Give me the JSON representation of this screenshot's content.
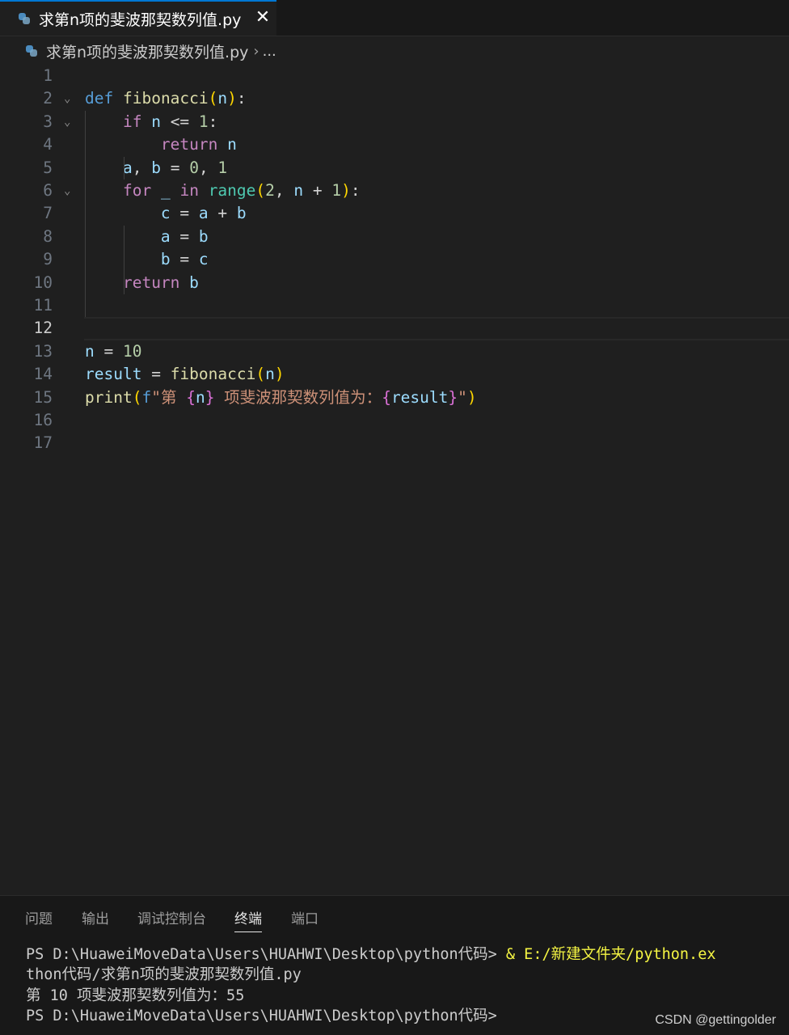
{
  "tab": {
    "title": "求第n项的斐波那契数列值.py",
    "icon": "python-icon",
    "close": "✕"
  },
  "breadcrumb": {
    "file": "求第n项的斐波那契数列值.py",
    "separator": "›",
    "more": "..."
  },
  "editor": {
    "current_line": 12,
    "lines": [
      {
        "n": "1",
        "tokens": []
      },
      {
        "n": "2",
        "fold": true,
        "tokens": [
          [
            "kw",
            "def"
          ],
          [
            "op",
            " "
          ],
          [
            "fn",
            "fibonacci"
          ],
          [
            "b1",
            "("
          ],
          [
            "var",
            "n"
          ],
          [
            "b1",
            ")"
          ],
          [
            "op",
            ":"
          ]
        ]
      },
      {
        "n": "3",
        "fold": true,
        "tokens": [
          [
            "op",
            "    "
          ],
          [
            "ctrl",
            "if"
          ],
          [
            "op",
            " "
          ],
          [
            "var",
            "n"
          ],
          [
            "op",
            " <= "
          ],
          [
            "num",
            "1"
          ],
          [
            "op",
            ":"
          ]
        ]
      },
      {
        "n": "4",
        "tokens": [
          [
            "op",
            "        "
          ],
          [
            "ctrl",
            "return"
          ],
          [
            "op",
            " "
          ],
          [
            "var",
            "n"
          ]
        ]
      },
      {
        "n": "5",
        "tokens": [
          [
            "op",
            "    "
          ],
          [
            "var",
            "a"
          ],
          [
            "op",
            ", "
          ],
          [
            "var",
            "b"
          ],
          [
            "op",
            " = "
          ],
          [
            "num",
            "0"
          ],
          [
            "op",
            ", "
          ],
          [
            "num",
            "1"
          ]
        ]
      },
      {
        "n": "6",
        "fold": true,
        "tokens": [
          [
            "op",
            "    "
          ],
          [
            "ctrl",
            "for"
          ],
          [
            "op",
            " "
          ],
          [
            "var",
            "_"
          ],
          [
            "op",
            " "
          ],
          [
            "ctrl",
            "in"
          ],
          [
            "op",
            " "
          ],
          [
            "builtin",
            "range"
          ],
          [
            "b1",
            "("
          ],
          [
            "num",
            "2"
          ],
          [
            "op",
            ", "
          ],
          [
            "var",
            "n"
          ],
          [
            "op",
            " + "
          ],
          [
            "num",
            "1"
          ],
          [
            "b1",
            ")"
          ],
          [
            "op",
            ":"
          ]
        ]
      },
      {
        "n": "7",
        "tokens": [
          [
            "op",
            "        "
          ],
          [
            "var",
            "c"
          ],
          [
            "op",
            " = "
          ],
          [
            "var",
            "a"
          ],
          [
            "op",
            " + "
          ],
          [
            "var",
            "b"
          ]
        ]
      },
      {
        "n": "8",
        "tokens": [
          [
            "op",
            "        "
          ],
          [
            "var",
            "a"
          ],
          [
            "op",
            " = "
          ],
          [
            "var",
            "b"
          ]
        ]
      },
      {
        "n": "9",
        "tokens": [
          [
            "op",
            "        "
          ],
          [
            "var",
            "b"
          ],
          [
            "op",
            " = "
          ],
          [
            "var",
            "c"
          ]
        ]
      },
      {
        "n": "10",
        "tokens": [
          [
            "op",
            "    "
          ],
          [
            "ctrl",
            "return"
          ],
          [
            "op",
            " "
          ],
          [
            "var",
            "b"
          ]
        ]
      },
      {
        "n": "11",
        "tokens": []
      },
      {
        "n": "12",
        "tokens": []
      },
      {
        "n": "13",
        "tokens": [
          [
            "var",
            "n"
          ],
          [
            "op",
            " = "
          ],
          [
            "num",
            "10"
          ]
        ]
      },
      {
        "n": "14",
        "tokens": [
          [
            "var",
            "result"
          ],
          [
            "op",
            " = "
          ],
          [
            "fn",
            "fibonacci"
          ],
          [
            "b1",
            "("
          ],
          [
            "var",
            "n"
          ],
          [
            "b1",
            ")"
          ]
        ]
      },
      {
        "n": "15",
        "tokens": [
          [
            "fn",
            "print"
          ],
          [
            "b1",
            "("
          ],
          [
            "kw",
            "f"
          ],
          [
            "str",
            "\"第 "
          ],
          [
            "b2",
            "{"
          ],
          [
            "var",
            "n"
          ],
          [
            "b2",
            "}"
          ],
          [
            "str",
            " 项斐波那契数列值为："
          ],
          [
            "b2",
            "{"
          ],
          [
            "var",
            "result"
          ],
          [
            "b2",
            "}"
          ],
          [
            "str",
            "\""
          ],
          [
            "b1",
            ")"
          ]
        ]
      },
      {
        "n": "16",
        "tokens": []
      },
      {
        "n": "17",
        "tokens": []
      }
    ]
  },
  "panel": {
    "tabs": [
      {
        "label": "问题",
        "active": false
      },
      {
        "label": "输出",
        "active": false
      },
      {
        "label": "调试控制台",
        "active": false
      },
      {
        "label": "终端",
        "active": true
      },
      {
        "label": "端口",
        "active": false
      }
    ],
    "terminal": {
      "line1_prompt": "PS D:\\HuaweiMoveData\\Users\\HUAHWI\\Desktop\\python代码> ",
      "line1_cmd": "& E:/新建文件夹/python.ex",
      "line2": "thon代码/求第n项的斐波那契数列值.py",
      "line3": "第 10 项斐波那契数列值为：55",
      "line4": "PS D:\\HuaweiMoveData\\Users\\HUAHWI\\Desktop\\python代码>"
    }
  },
  "watermark": "CSDN @gettingolder",
  "colors": {
    "editor_bg": "#1f1f1f",
    "keyword": "#569cd6",
    "control": "#c586c0",
    "function": "#dcdcaa",
    "variable": "#9cdcfe",
    "number": "#b5cea8",
    "string": "#ce9178",
    "bracket1": "#ffd700",
    "bracket2": "#da70d6",
    "builtin": "#4ec9b0"
  }
}
